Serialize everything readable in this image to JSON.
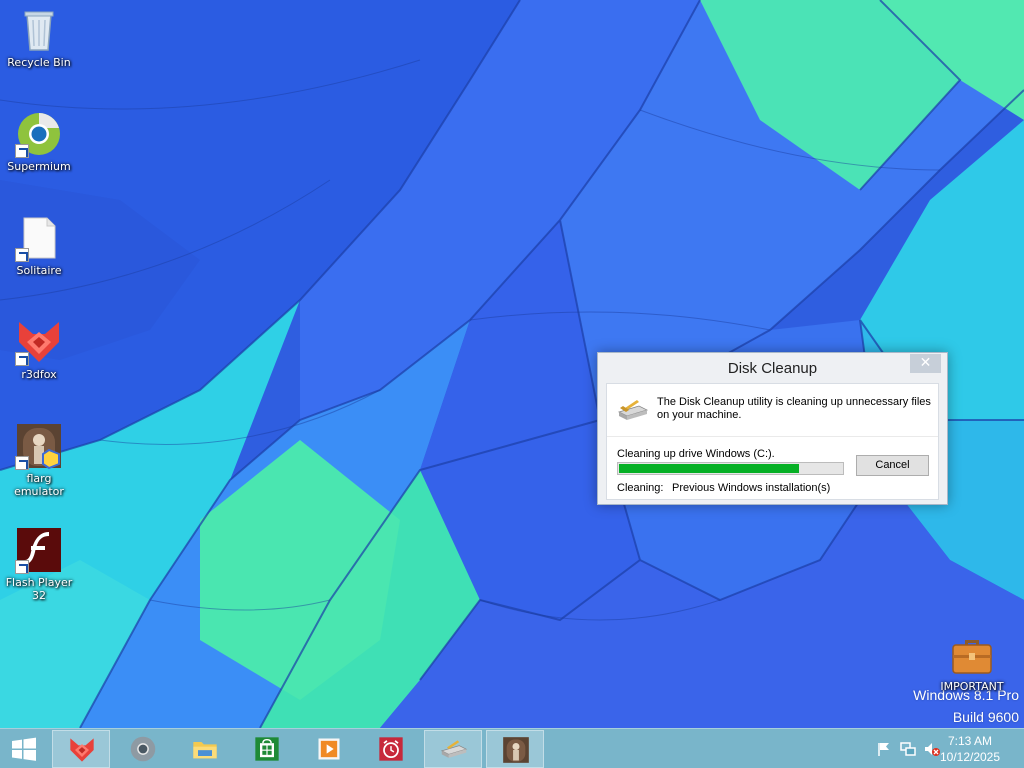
{
  "desktop": {
    "icons": [
      {
        "label": "Recycle Bin",
        "icon": "recycle-bin-icon"
      },
      {
        "label": "Supermium",
        "icon": "supermium-browser-icon"
      },
      {
        "label": "Solitaire",
        "icon": "blank-file-icon"
      },
      {
        "label": "r3dfox",
        "icon": "r3dfox-browser-icon"
      },
      {
        "label": "flarg\nemulator",
        "icon": "flarg-emulator-icon"
      },
      {
        "label": "Flash Player\n32",
        "icon": "flash-player-icon"
      },
      {
        "label": "IMPORTANT",
        "icon": "briefcase-icon"
      }
    ],
    "watermark": {
      "line1": "Windows 8.1 Pro",
      "line2": "Build 9600"
    }
  },
  "dialog": {
    "title": "Disk Cleanup",
    "close_label": "✕",
    "message": "The Disk Cleanup utility is cleaning up unnecessary files on your machine.",
    "progress_label": "Cleaning up drive Windows (C:).",
    "progress_fraction": 0.8,
    "cancel_label": "Cancel",
    "status_label": "Cleaning:",
    "status_value": "Previous Windows installation(s)"
  },
  "taskbar": {
    "apps": [
      {
        "name": "r3dfox",
        "icon": "r3dfox-browser-icon",
        "active": true
      },
      {
        "name": "Supermium",
        "icon": "supermium-browser-icon",
        "active": false
      },
      {
        "name": "File Explorer",
        "icon": "folder-icon",
        "active": false
      },
      {
        "name": "Store",
        "icon": "store-bag-icon",
        "active": false
      },
      {
        "name": "Video",
        "icon": "video-play-icon",
        "active": false
      },
      {
        "name": "Alarms",
        "icon": "alarm-clock-icon",
        "active": false
      },
      {
        "name": "Disk Cleanup",
        "icon": "disk-cleanup-icon",
        "active": true
      },
      {
        "name": "flarg emulator",
        "icon": "flarg-emulator-icon",
        "active": true
      }
    ],
    "tray": {
      "icons": [
        "flag-icon",
        "network-icon",
        "speaker-muted-icon"
      ],
      "time": "7:13 AM",
      "date": "10/12/2025"
    }
  },
  "colors": {
    "progress_fill": "#06b025",
    "taskbar": "#5ca5be"
  }
}
